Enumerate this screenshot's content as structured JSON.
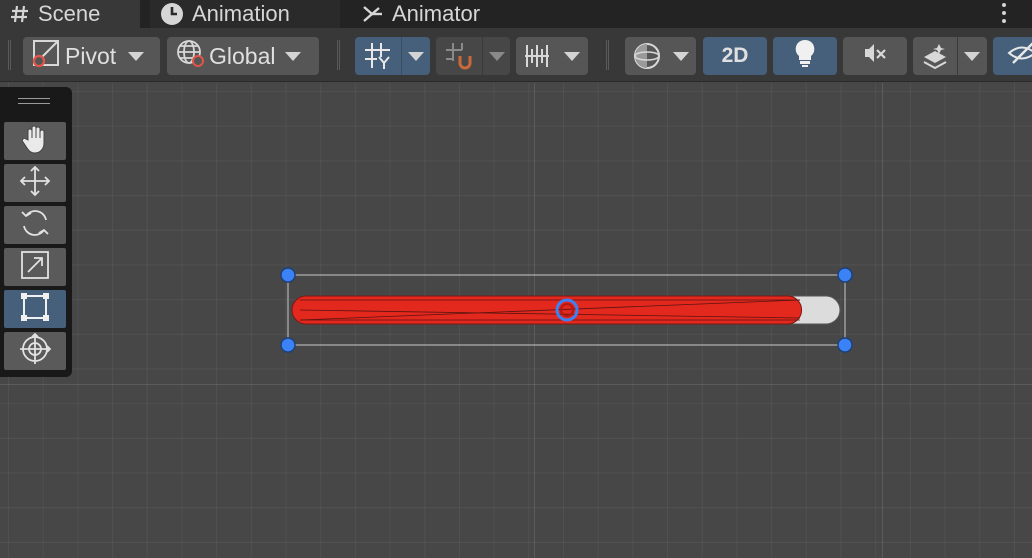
{
  "tabs": [
    {
      "label": "Scene",
      "icon": "hash-icon",
      "active": true
    },
    {
      "label": "Animation",
      "icon": "clock-icon",
      "active": false
    },
    {
      "label": "Animator",
      "icon": "animator-icon",
      "active": false
    }
  ],
  "toolbar": {
    "pivot_label": "Pivot",
    "global_label": "Global",
    "mode_2d_label": "2D"
  },
  "tools": [
    {
      "name": "hand-tool",
      "icon": "hand-icon",
      "active": false
    },
    {
      "name": "move-tool",
      "icon": "move-arrows-icon",
      "active": false
    },
    {
      "name": "rotate-tool",
      "icon": "rotate-icon",
      "active": false
    },
    {
      "name": "scale-tool",
      "icon": "scale-icon",
      "active": false
    },
    {
      "name": "rect-tool",
      "icon": "rect-transform-icon",
      "active": true
    },
    {
      "name": "transform-tool",
      "icon": "transform-icon",
      "active": false
    }
  ],
  "scene_object": {
    "type": "slider",
    "fill_fraction": 0.93,
    "fill_color": "#e3281e",
    "track_color": "#dcdcdc",
    "handle_color": "#3b82f6"
  },
  "colors": {
    "accent_blue": "#46607c",
    "tab_bar": "#232323",
    "toolbar": "#383838",
    "scene_bg": "#474747"
  }
}
